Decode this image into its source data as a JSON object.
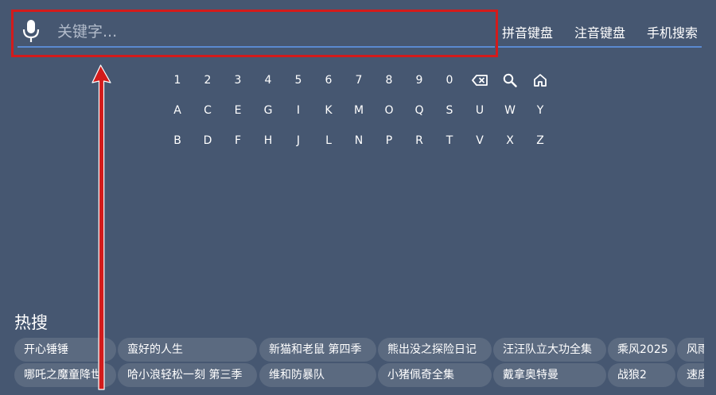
{
  "search": {
    "placeholder": "关键字...",
    "value": ""
  },
  "mode_tabs": [
    "拼音键盘",
    "注音键盘",
    "手机搜索"
  ],
  "keyboard": {
    "row1": [
      "1",
      "2",
      "3",
      "4",
      "5",
      "6",
      "7",
      "8",
      "9",
      "0"
    ],
    "row1_icons": [
      "backspace-icon",
      "search-icon",
      "home-icon"
    ],
    "row2": [
      "A",
      "C",
      "E",
      "G",
      "I",
      "K",
      "M",
      "O",
      "Q",
      "S",
      "U",
      "W",
      "Y"
    ],
    "row3": [
      "B",
      "D",
      "F",
      "H",
      "J",
      "L",
      "N",
      "P",
      "R",
      "T",
      "V",
      "X",
      "Z"
    ]
  },
  "hot": {
    "title": "热搜",
    "row1": [
      "开心锤锤",
      "蛮好的人生",
      "新猫和老鼠 第四季",
      "熊出没之探险日记",
      "汪汪队立大功全集",
      "乘风2025",
      "风雨"
    ],
    "row2": [
      "哪吒之魔童降世",
      "哈小浪轻松一刻 第三季",
      "维和防暴队",
      "小猪佩奇全集",
      "戴拿奥特曼",
      "战狼2",
      "速度"
    ]
  },
  "colors": {
    "background": "#465771",
    "chip": "#5b6a80",
    "underline": "#5a8ad0",
    "annotation_red": "#d31b1b"
  }
}
